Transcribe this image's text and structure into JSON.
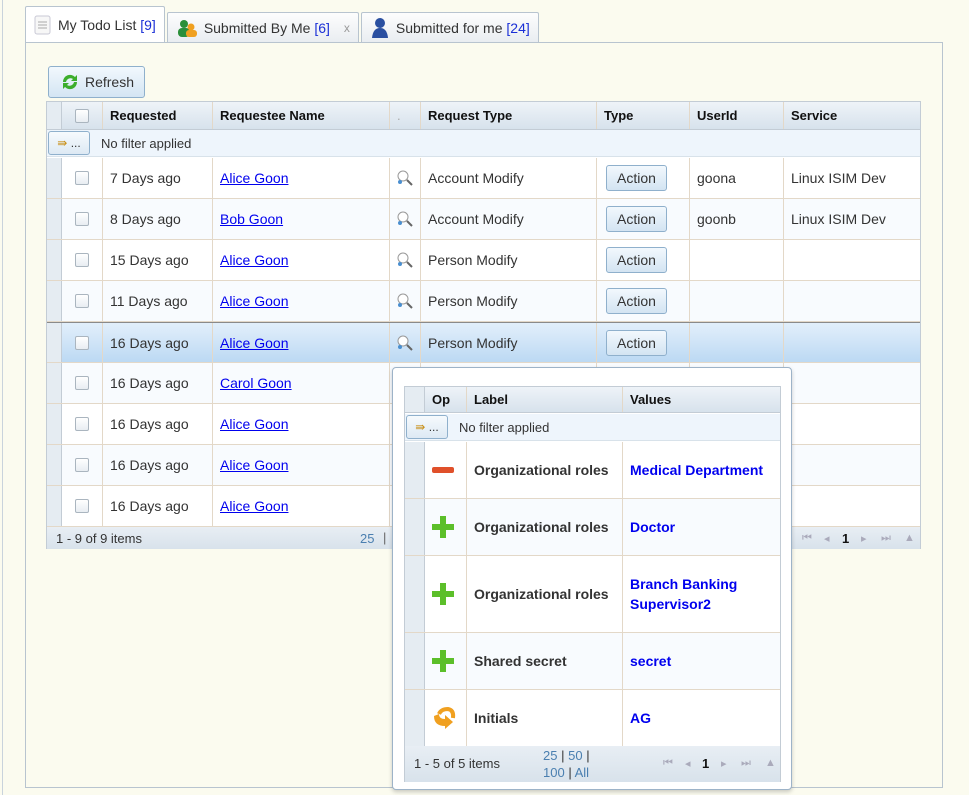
{
  "tabs": [
    {
      "label": "My Todo List",
      "count": "[9]",
      "icon": "todo-list-icon",
      "active": true
    },
    {
      "label": "Submitted By Me",
      "count": "[6]",
      "icon": "users-group-icon",
      "close": "x"
    },
    {
      "label": "Submitted for me",
      "count": "[24]",
      "icon": "user-icon"
    }
  ],
  "toolbar": {
    "refresh_label": "Refresh"
  },
  "grid": {
    "columns": [
      "Requested",
      "Requestee Name",
      ".",
      "Request Type",
      "Type",
      "UserId",
      "Service"
    ],
    "filter_button": "...",
    "filter_text": "No filter applied",
    "rows": [
      {
        "requested": "7 Days ago",
        "name": "Alice Goon",
        "request_type": "Account Modify",
        "type": "Action",
        "userid": "goona",
        "service": "Linux ISIM Dev"
      },
      {
        "requested": "8 Days ago",
        "name": "Bob Goon",
        "request_type": "Account Modify",
        "type": "Action",
        "userid": "goonb",
        "service": "Linux ISIM Dev"
      },
      {
        "requested": "15 Days ago",
        "name": "Alice Goon",
        "request_type": "Person Modify",
        "type": "Action",
        "userid": "",
        "service": ""
      },
      {
        "requested": "11 Days ago",
        "name": "Alice Goon",
        "request_type": "Person Modify",
        "type": "Action",
        "userid": "",
        "service": ""
      },
      {
        "requested": "16 Days ago",
        "name": "Alice Goon",
        "request_type": "Person Modify",
        "type": "Action",
        "userid": "",
        "service": "",
        "selected": true
      },
      {
        "requested": "16 Days ago",
        "name": "Carol Goon",
        "request_type": "",
        "type": "",
        "userid": "",
        "service": ""
      },
      {
        "requested": "16 Days ago",
        "name": "Alice Goon",
        "request_type": "",
        "type": "",
        "userid": "",
        "service": ""
      },
      {
        "requested": "16 Days ago",
        "name": "Alice Goon",
        "request_type": "",
        "type": "",
        "userid": "",
        "service": ""
      },
      {
        "requested": "16 Days ago",
        "name": "Alice Goon",
        "request_type": "",
        "type": "",
        "userid": "",
        "service": ""
      }
    ],
    "footer": {
      "summary": "1 - 9 of 9 items",
      "page_size": "25",
      "sep": "|",
      "page": "1"
    }
  },
  "popup": {
    "columns": [
      "Op",
      "Label",
      "Values"
    ],
    "filter_button": "...",
    "filter_text": "No filter applied",
    "rows": [
      {
        "op": "remove",
        "label": "Organizational roles",
        "value": "Medical Department"
      },
      {
        "op": "add",
        "label": "Organizational roles",
        "value": "Doctor"
      },
      {
        "op": "add",
        "label": "Organizational roles",
        "value": "Branch Banking Supervisor2"
      },
      {
        "op": "add",
        "label": "Shared secret",
        "value": "secret"
      },
      {
        "op": "modify",
        "label": "Initials",
        "value": "AG"
      }
    ],
    "footer": {
      "summary": "1 - 5 of 5 items",
      "sizes": [
        "25",
        "50",
        "100",
        "All"
      ],
      "sep": "|",
      "page": "1"
    }
  },
  "colors": {
    "link": "#0000ee",
    "count": "#1a2fd6",
    "remove": "#e0502a",
    "add": "#5cbf2a",
    "modify": "#f0a020"
  }
}
